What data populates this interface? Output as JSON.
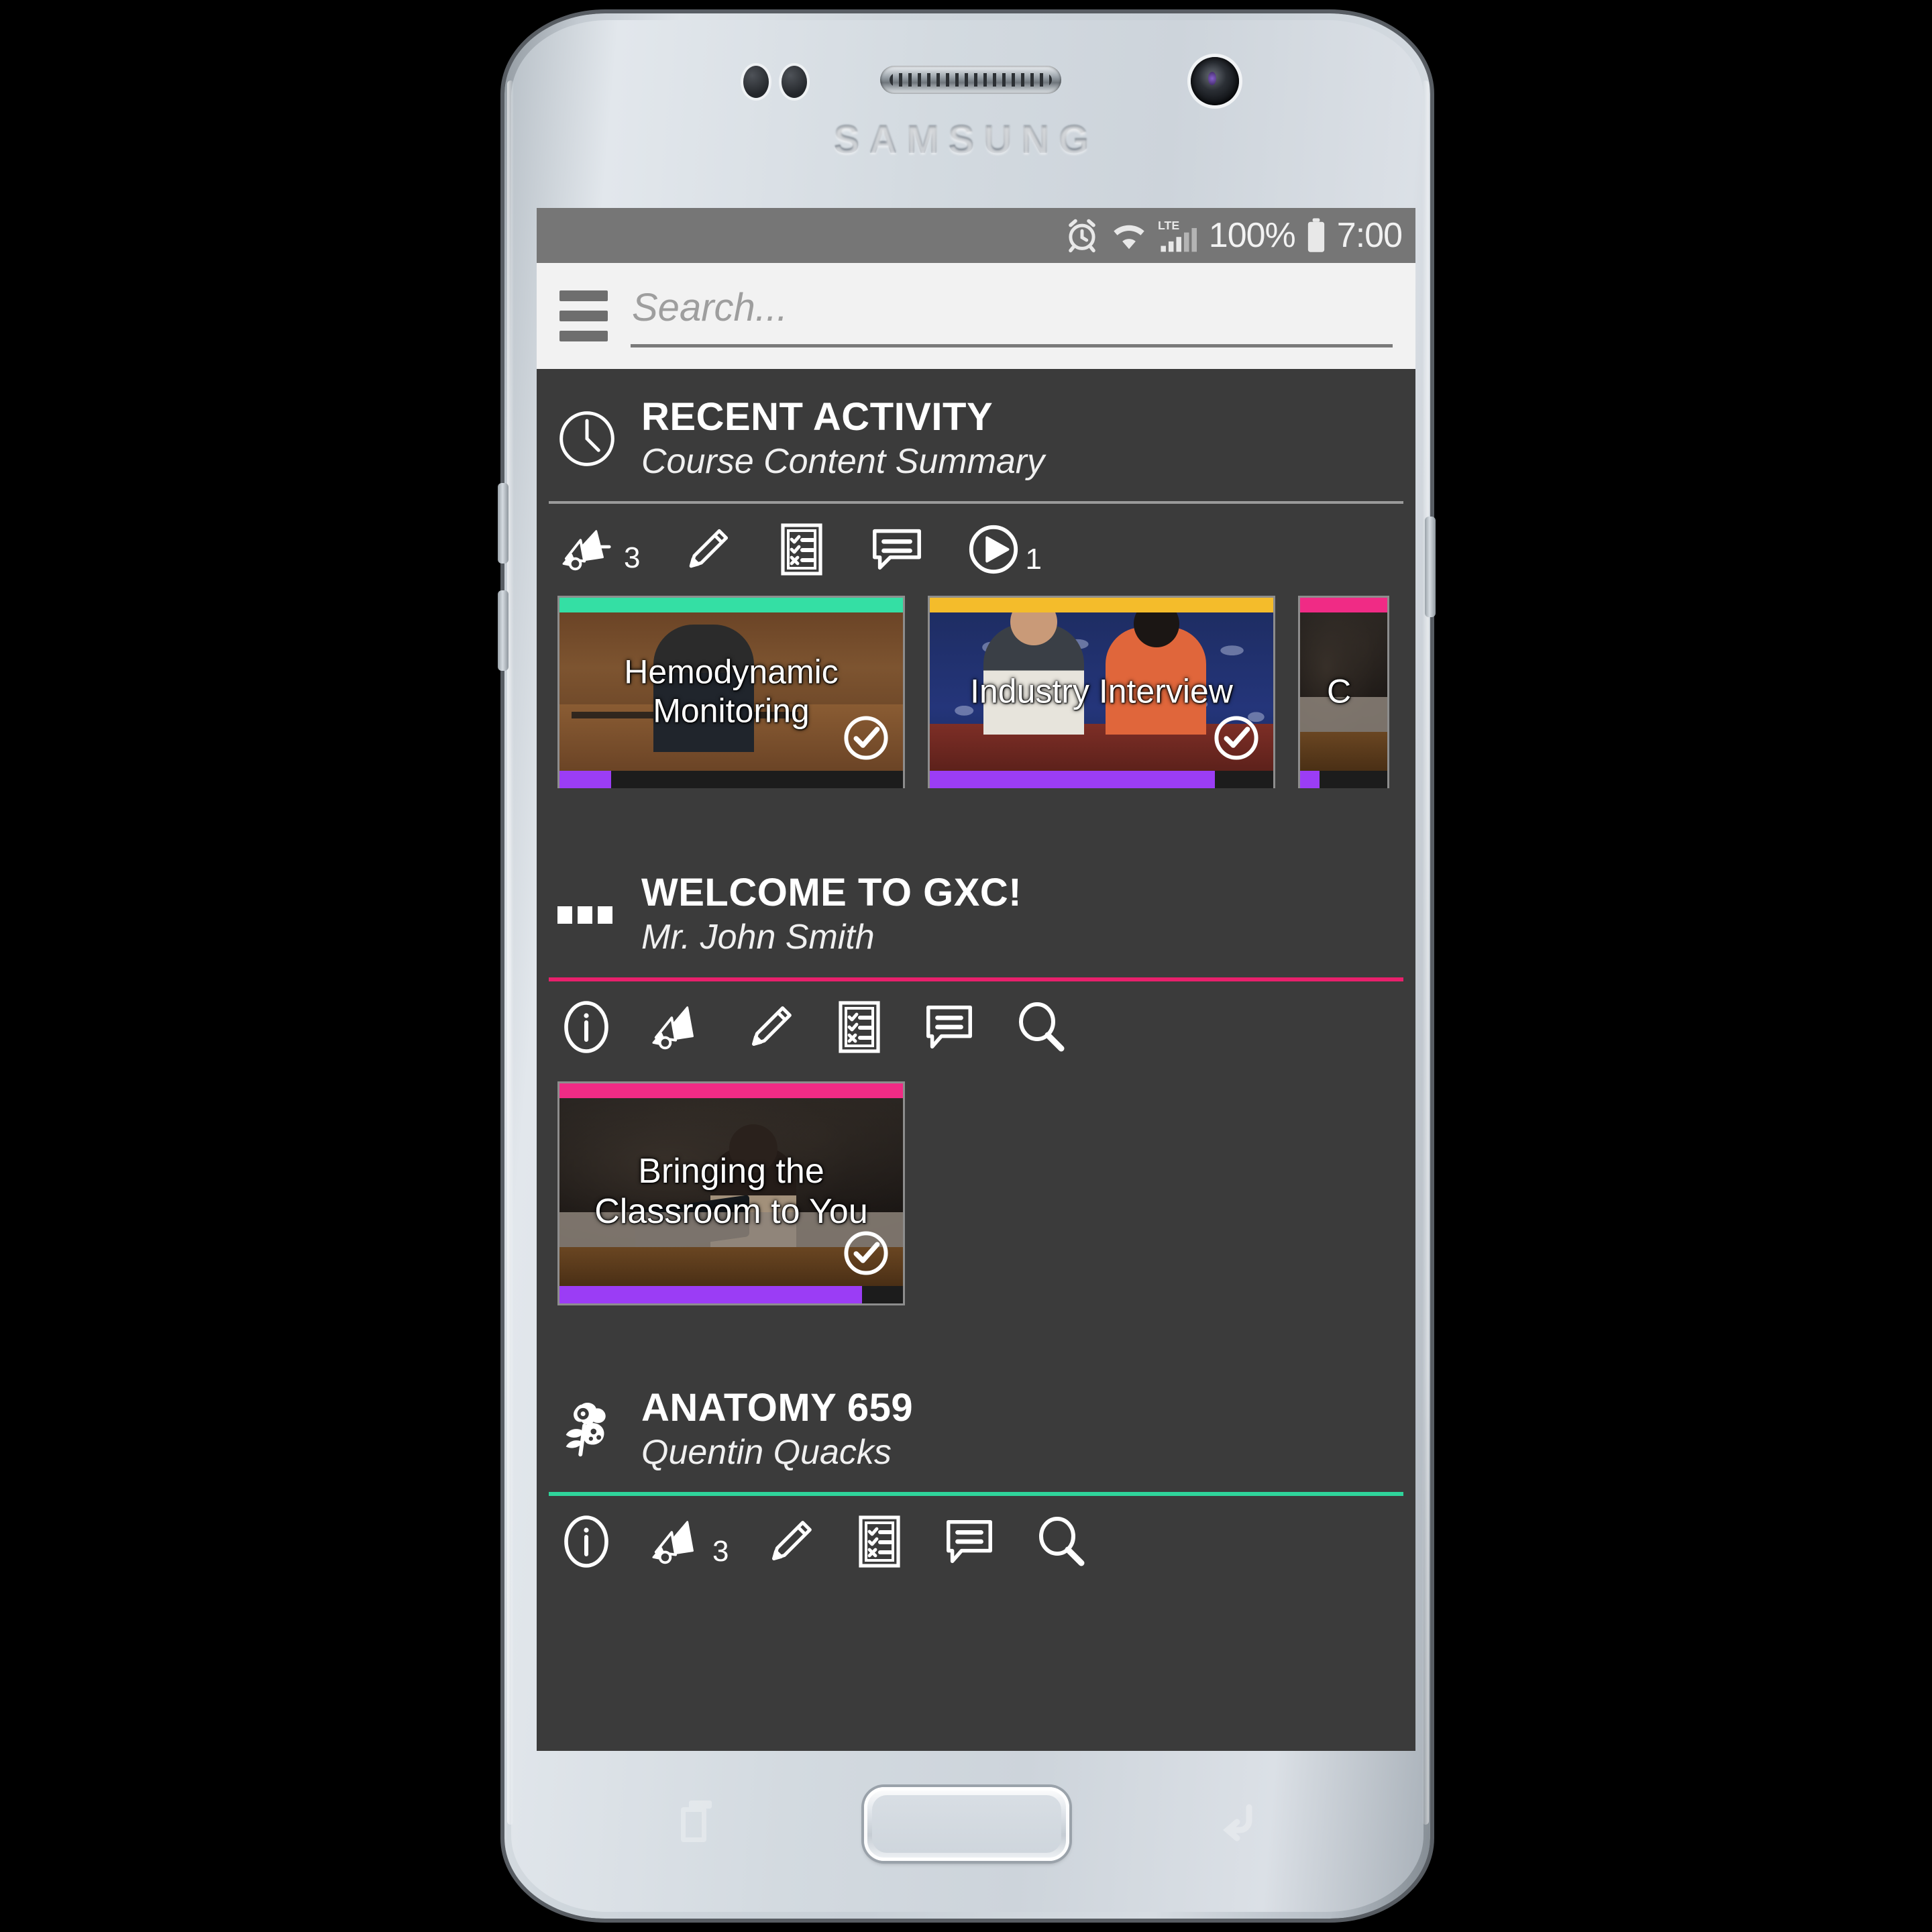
{
  "device": {
    "brand": "SAMSUNG"
  },
  "statusbar": {
    "alarm_icon": "alarm-clock-icon",
    "wifi_icon": "wifi-icon",
    "network_label": "LTE",
    "signal_icon": "cellular-signal-icon",
    "battery_percent": "100%",
    "battery_icon": "battery-full-icon",
    "time": "7:00"
  },
  "appbar": {
    "menu_icon": "hamburger-menu-icon",
    "search_placeholder": "Search...",
    "search_value": ""
  },
  "sections": [
    {
      "id": "recent-activity",
      "icon": "clock-icon",
      "title": "RECENT ACTIVITY",
      "subtitle": "Course Content Summary",
      "divider_color": "#9a9a9a",
      "actions": [
        {
          "icon": "megaphone-icon",
          "name": "announcements",
          "count": "3"
        },
        {
          "icon": "pencil-icon",
          "name": "assignments",
          "count": ""
        },
        {
          "icon": "checklist-icon",
          "name": "quizzes",
          "count": ""
        },
        {
          "icon": "chat-icon",
          "name": "discussions",
          "count": ""
        },
        {
          "icon": "play-icon",
          "name": "videos",
          "count": "1"
        }
      ],
      "cards": [
        {
          "title": "Hemodynamic Monitoring",
          "accent": "#34dfa4",
          "progress": 15,
          "completed": true,
          "art": "lecture"
        },
        {
          "title": "Industry Interview",
          "accent": "#f4bc2b",
          "progress": 83,
          "completed": true,
          "art": "interview"
        },
        {
          "title": "C",
          "accent": "#f02b85",
          "progress": 22,
          "completed": false,
          "art": "class"
        }
      ]
    },
    {
      "id": "welcome-gxc",
      "icon": "bars-icon",
      "title": "WELCOME TO GXC!",
      "subtitle": "Mr. John Smith",
      "divider_color": "#e8206c",
      "actions": [
        {
          "icon": "info-icon",
          "name": "info",
          "count": ""
        },
        {
          "icon": "megaphone-icon",
          "name": "announcements",
          "count": ""
        },
        {
          "icon": "pencil-icon",
          "name": "assignments",
          "count": ""
        },
        {
          "icon": "checklist-icon",
          "name": "quizzes",
          "count": ""
        },
        {
          "icon": "chat-icon",
          "name": "discussions",
          "count": ""
        },
        {
          "icon": "search-icon",
          "name": "search",
          "count": ""
        }
      ],
      "cards": [
        {
          "title": "Bringing the Classroom to You",
          "accent": "#f02b85",
          "progress": 88,
          "completed": true,
          "art": "class"
        }
      ]
    },
    {
      "id": "anatomy-659",
      "icon": "flower-icon",
      "title": "ANATOMY 659",
      "subtitle": "Quentin Quacks",
      "divider_color": "#2fd49b",
      "actions": [
        {
          "icon": "info-icon",
          "name": "info",
          "count": ""
        },
        {
          "icon": "megaphone-icon",
          "name": "announcements",
          "count": "3"
        },
        {
          "icon": "pencil-icon",
          "name": "assignments",
          "count": ""
        },
        {
          "icon": "checklist-icon",
          "name": "quizzes",
          "count": ""
        },
        {
          "icon": "chat-icon",
          "name": "discussions",
          "count": ""
        },
        {
          "icon": "search-icon",
          "name": "search",
          "count": ""
        }
      ],
      "cards": []
    }
  ],
  "navbar": {
    "recents_icon": "recents-icon",
    "home_icon": "home-button",
    "back_icon": "back-arrow-icon"
  }
}
